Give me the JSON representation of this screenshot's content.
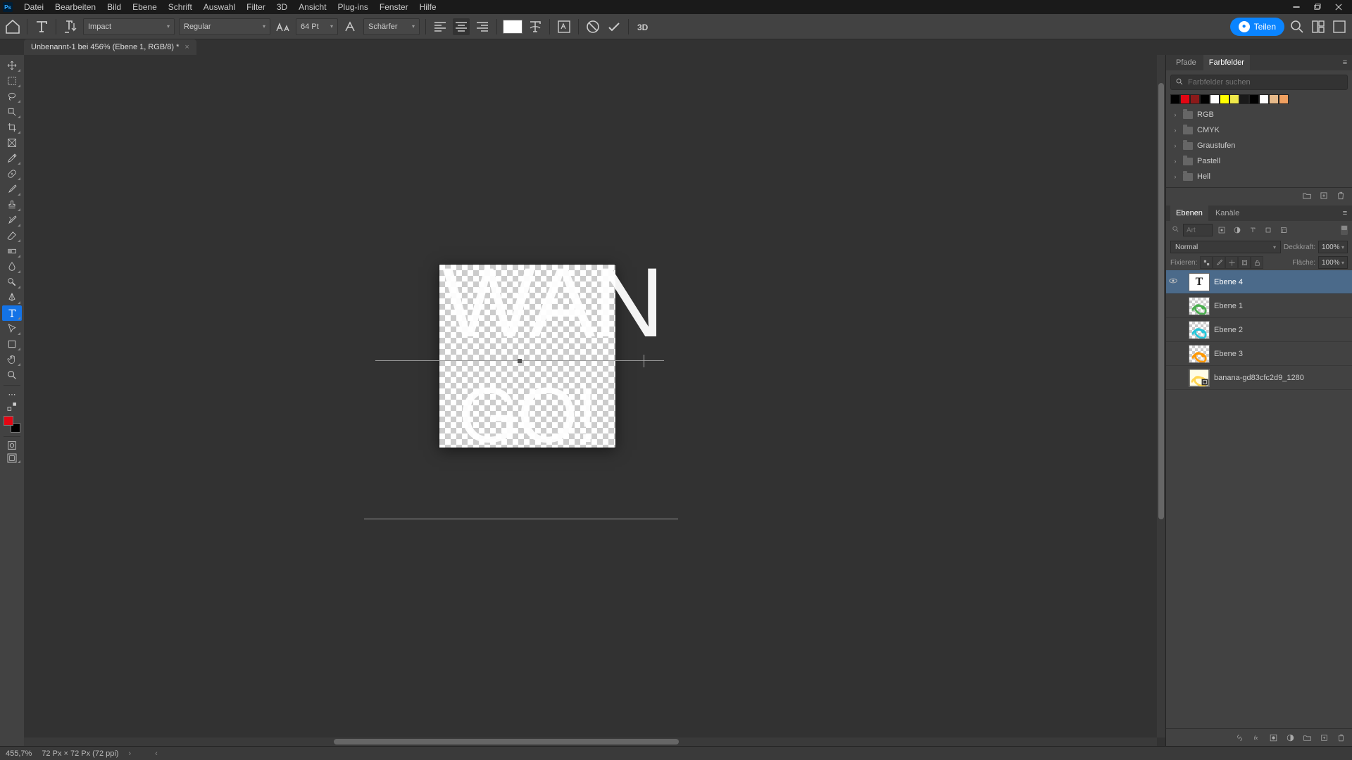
{
  "titlebar": {
    "app_badge": "Ps",
    "menus": [
      "Datei",
      "Bearbeiten",
      "Bild",
      "Ebene",
      "Schrift",
      "Auswahl",
      "Filter",
      "3D",
      "Ansicht",
      "Plug-ins",
      "Fenster",
      "Hilfe"
    ]
  },
  "options": {
    "font_family": "Impact",
    "font_style": "Regular",
    "font_size": "64 Pt",
    "antialias": "Schärfer",
    "color": "#ffffff",
    "share_label": "Teilen"
  },
  "document": {
    "tab_title": "Unbenannt-1 bei 456% (Ebene 1, RGB/8) *"
  },
  "canvas": {
    "top_text": "WAN",
    "bottom_text": "GO!"
  },
  "swatches": {
    "tab_paths": "Pfade",
    "tab_swatches": "Farbfelder",
    "search_placeholder": "Farbfelder suchen",
    "colors": [
      "#000000",
      "#e30613",
      "#8b1a1a",
      "#000000",
      "#ffffff",
      "#ffff00",
      "#f0e94a",
      "#1a1a1a",
      "#000000",
      "#ffffff",
      "#e6b98a",
      "#f0a060"
    ],
    "folders": [
      "RGB",
      "CMYK",
      "Graustufen",
      "Pastell",
      "Hell"
    ]
  },
  "layers_panel": {
    "tab_layers": "Ebenen",
    "tab_channels": "Kanäle",
    "filter_placeholder": "Art",
    "blend_mode": "Normal",
    "opacity_label": "Deckkraft:",
    "opacity_value": "100%",
    "lock_label": "Fixieren:",
    "fill_label": "Fläche:",
    "fill_value": "100%",
    "layers": [
      {
        "name": "Ebene 4",
        "type": "text",
        "visible": true,
        "selected": true
      },
      {
        "name": "Ebene 1",
        "type": "image",
        "visible": false,
        "selected": false,
        "swirl": "#4caf50"
      },
      {
        "name": "Ebene 2",
        "type": "image",
        "visible": false,
        "selected": false,
        "swirl": "#26c6da"
      },
      {
        "name": "Ebene 3",
        "type": "image",
        "visible": false,
        "selected": false,
        "swirl": "#ff9800"
      },
      {
        "name": "banana-gd83cfc2d9_1280",
        "type": "smartobj",
        "visible": false,
        "selected": false,
        "swirl": "#ffd54f"
      }
    ]
  },
  "statusbar": {
    "zoom": "455,7%",
    "dims": "72 Px × 72 Px (72 ppi)"
  }
}
